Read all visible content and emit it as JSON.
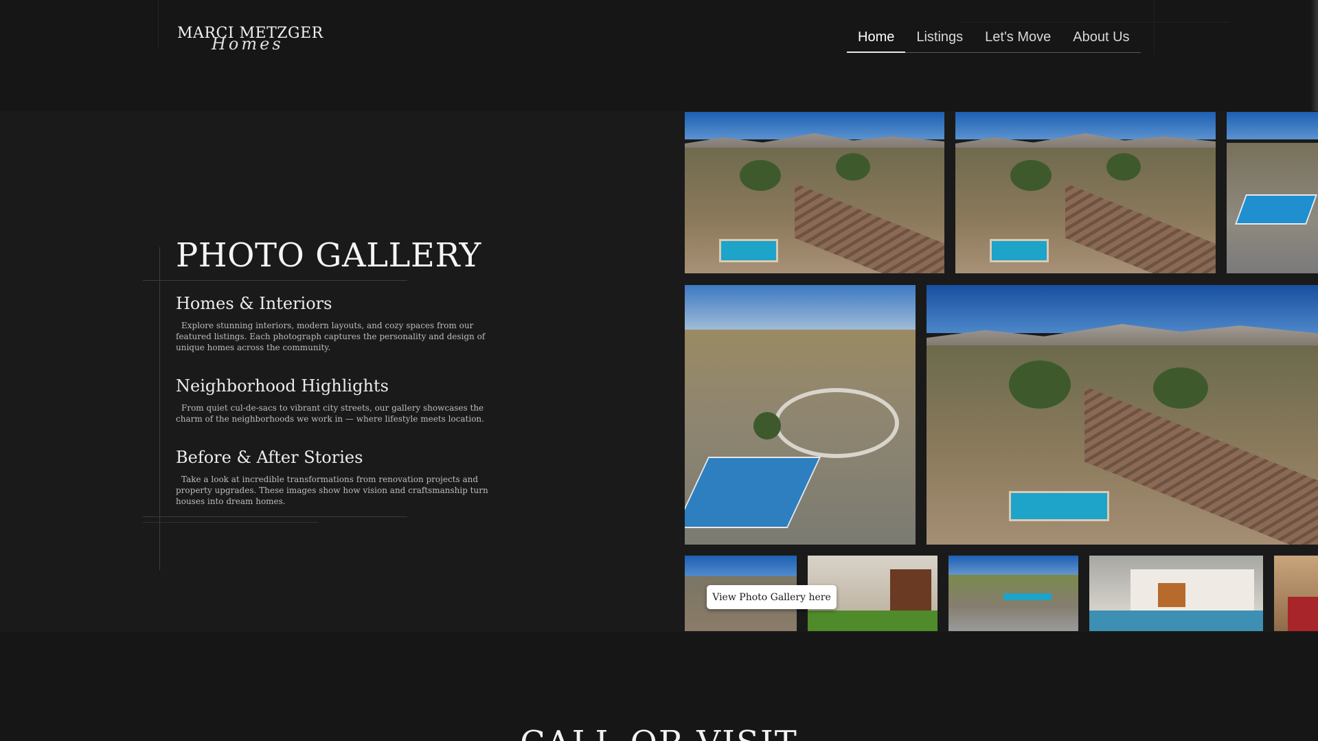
{
  "brand": {
    "logo_main": "MARCI METZGER",
    "logo_script": "Homes"
  },
  "nav": {
    "items": [
      {
        "label": "Home",
        "active": true
      },
      {
        "label": "Listings",
        "active": false
      },
      {
        "label": "Let's Move",
        "active": false
      },
      {
        "label": "About Us",
        "active": false
      }
    ]
  },
  "gallery": {
    "title": "PHOTO GALLERY",
    "sections": [
      {
        "heading": "Homes & Interiors",
        "text": "Explore stunning interiors, modern layouts, and cozy spaces from our featured listings. Each photograph captures the personality and design of unique homes across the community."
      },
      {
        "heading": "Neighborhood Highlights",
        "text": "From quiet cul-de-sacs to vibrant city streets, our gallery showcases the charm of the neighborhoods we work in — where lifestyle meets location."
      },
      {
        "heading": "Before & After Stories",
        "text": "Take a look at incredible transformations from renovation projects and property upgrades. These images show how vision and craftsmanship turn houses into dream homes."
      }
    ],
    "view_button": "View Photo Gallery here"
  },
  "photos": [
    {
      "name": "aerial-home-pool-1"
    },
    {
      "name": "aerial-home-pool-2"
    },
    {
      "name": "aerial-tennis-courts-partial"
    },
    {
      "name": "aerial-community-park"
    },
    {
      "name": "aerial-home-pool-large"
    },
    {
      "name": "aerial-neighborhood-small"
    },
    {
      "name": "home-entrance-door"
    },
    {
      "name": "aerial-golf-course"
    },
    {
      "name": "villa-pool-exterior"
    },
    {
      "name": "interior-red-chair-partial"
    }
  ],
  "footer_section": {
    "title": "CALL OR VISIT"
  },
  "colors": {
    "background": "#161616",
    "section_bg": "#1a1a1a",
    "text": "#e8e8e8",
    "button_bg": "#ffffff"
  }
}
